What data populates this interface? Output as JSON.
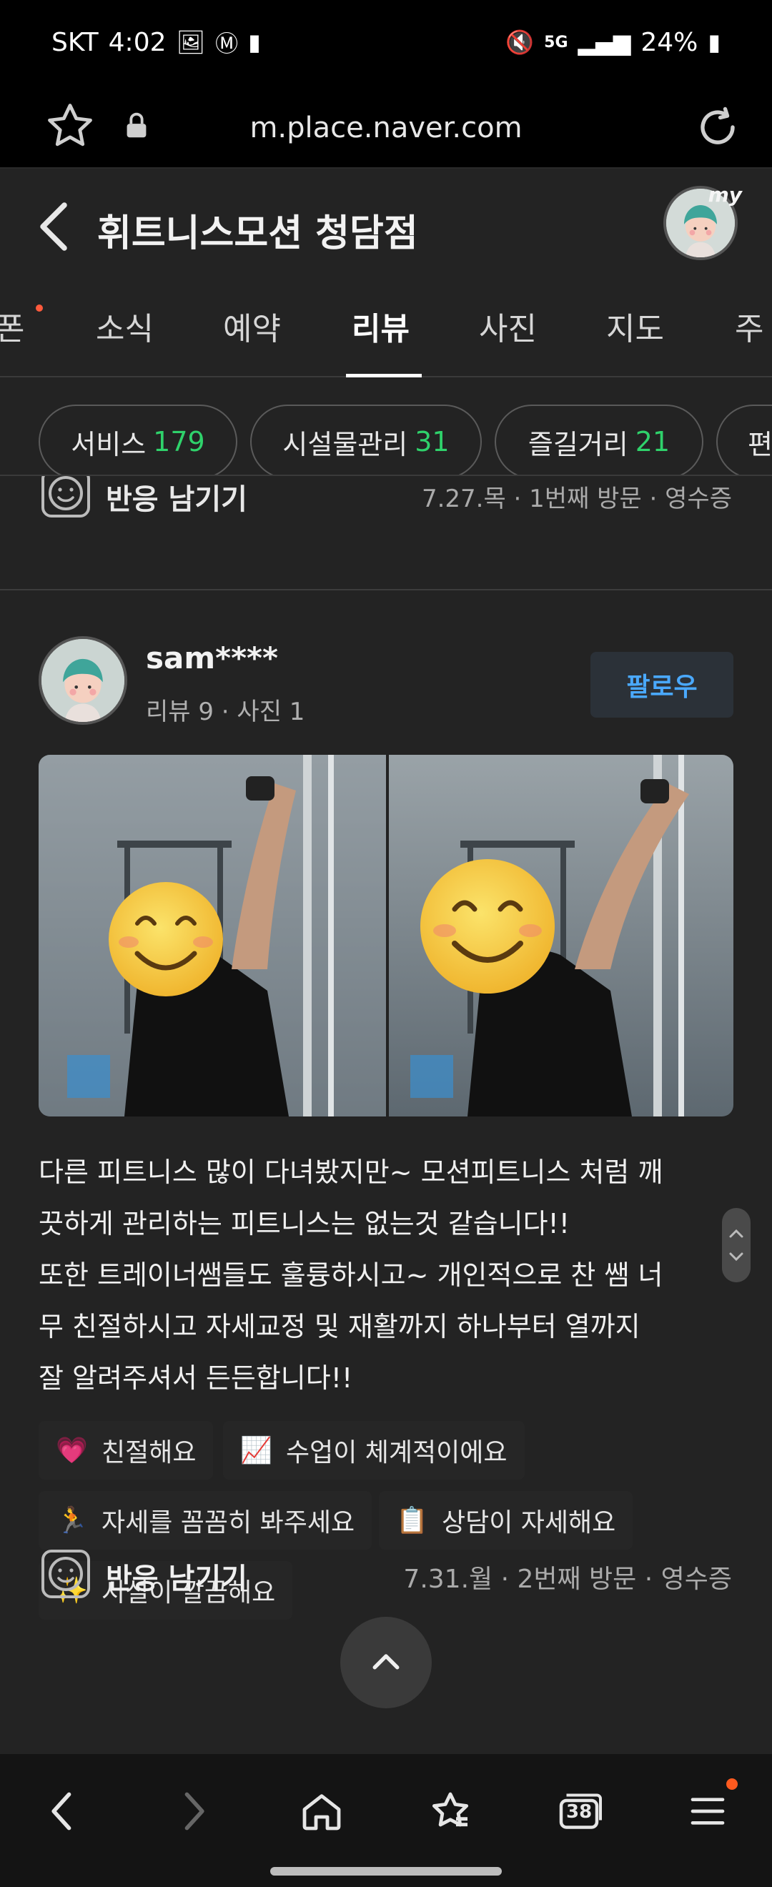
{
  "status_bar": {
    "carrier": "SKT",
    "time": "4:02",
    "network": "5G",
    "battery": "24%"
  },
  "browser": {
    "url": "m.place.naver.com"
  },
  "header": {
    "title": "휘트니스모션 청담점",
    "my_label": "my"
  },
  "tabs": [
    {
      "label": "폰"
    },
    {
      "label": "소식"
    },
    {
      "label": "예약"
    },
    {
      "label": "리뷰"
    },
    {
      "label": "사진"
    },
    {
      "label": "지도"
    },
    {
      "label": "주"
    }
  ],
  "chips": [
    {
      "label": "서비스",
      "count": "179"
    },
    {
      "label": "시설물관리",
      "count": "31"
    },
    {
      "label": "즐길거리",
      "count": "21"
    },
    {
      "label": "편",
      "count": ""
    }
  ],
  "prev_review": {
    "react_label": "반응 남기기",
    "meta": "7.27.목 · 1번째 방문 · 영수증"
  },
  "review": {
    "author": "sam****",
    "stats": "리뷰 9 · 사진 1",
    "follow_label": "팔로우",
    "text": "다른 피트니스 많이 다녀봤지만~ 모션피트니스 처럼 깨끗하게 관리하는 피트니스는 없는것 같습니다!! 또한 트레이너쌤들도 훌륭하시고~ 개인적으로 찬 쌤 너무 친절하시고 자세교정 및 재활까지 하나부터 열까지 잘 알려주셔서 든든합니다!!",
    "text_lines": [
      "다른 피트니스 많이 다녀봤지만~ 모션피트니스 처럼 깨",
      "끗하게 관리하는 피트니스는 없는것 같습니다!!",
      "또한 트레이너쌤들도 훌륭하시고~ 개인적으로 찬 쌤 너",
      "무 친절하시고 자세교정 및 재활까지 하나부터 열까지",
      "잘 알려주셔서 든든합니다!!"
    ],
    "tags": [
      {
        "emoji": "💗",
        "label": "친절해요"
      },
      {
        "emoji": "📈",
        "label": "수업이 체계적이에요"
      },
      {
        "emoji": "🏃",
        "label": "자세를 꼼꼼히 봐주세요"
      },
      {
        "emoji": "📋",
        "label": "상담이 자세해요"
      },
      {
        "emoji": "✨",
        "label": "시설이 깔끔해요"
      }
    ],
    "react_label": "반응 남기기",
    "meta": "7.31.월 · 2번째 방문 · 영수증"
  },
  "bottom_nav": {
    "tab_count": "38"
  },
  "colors": {
    "accent_green": "#2fd26b",
    "follow_blue": "#4aa9ff",
    "badge_orange": "#ff5a1f"
  }
}
